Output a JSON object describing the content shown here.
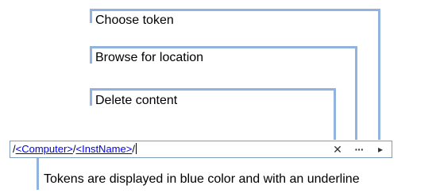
{
  "callouts": {
    "choose_token": "Choose token",
    "browse_location": "Browse for location",
    "delete_content": "Delete content",
    "tokens_note": "Tokens are displayed in blue color and with an underline"
  },
  "path_field": {
    "separator": "/",
    "tokens": [
      "<Computer>",
      "<InstName>"
    ]
  },
  "buttons": {
    "delete_glyph": "✕",
    "browse_glyph": "···",
    "choose_glyph": "▸"
  },
  "colors": {
    "leader": "#92b3e0",
    "token": "#0000ee",
    "field_border": "#7f9db9"
  }
}
